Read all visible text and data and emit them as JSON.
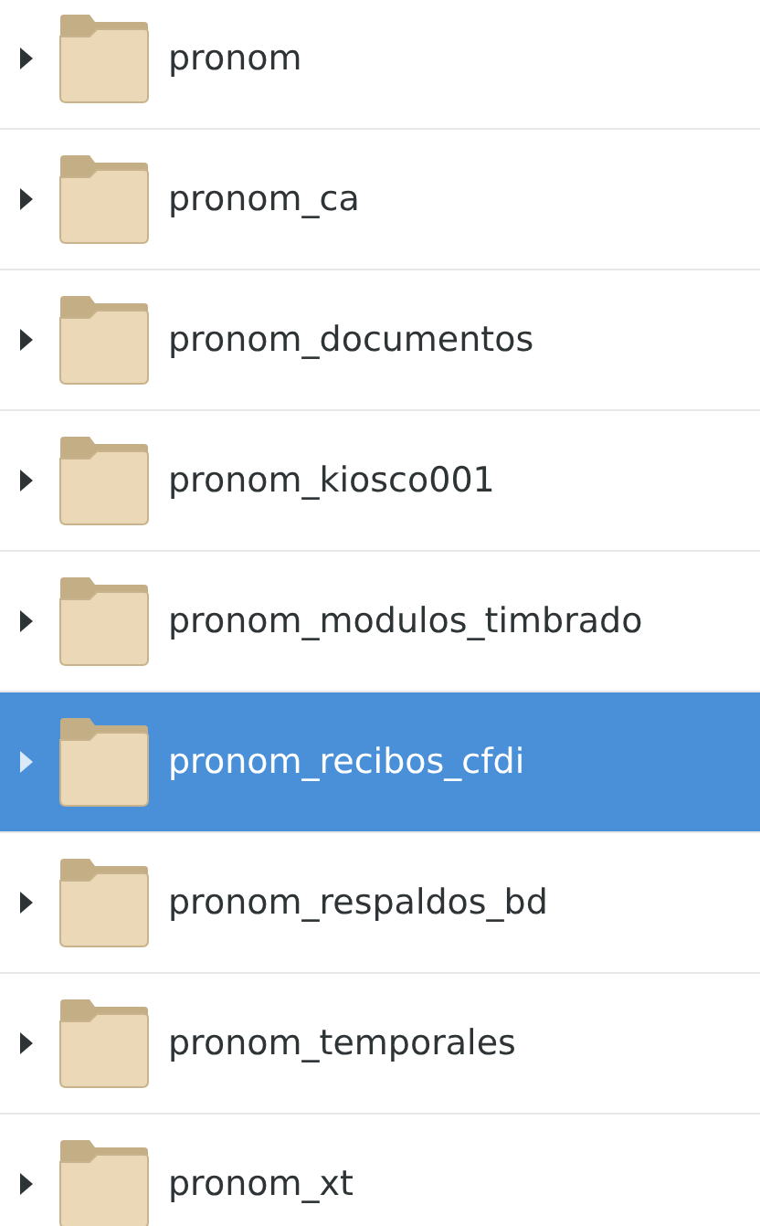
{
  "folders": [
    {
      "name": "pronom",
      "selected": false,
      "expanded": false
    },
    {
      "name": "pronom_ca",
      "selected": false,
      "expanded": false
    },
    {
      "name": "pronom_documentos",
      "selected": false,
      "expanded": false
    },
    {
      "name": "pronom_kiosco001",
      "selected": false,
      "expanded": false
    },
    {
      "name": "pronom_modulos_timbrado",
      "selected": false,
      "expanded": false
    },
    {
      "name": "pronom_recibos_cfdi",
      "selected": true,
      "expanded": false
    },
    {
      "name": "pronom_respaldos_bd",
      "selected": false,
      "expanded": false
    },
    {
      "name": "pronom_temporales",
      "selected": false,
      "expanded": false
    },
    {
      "name": "pronom_xt",
      "selected": false,
      "expanded": false
    }
  ]
}
